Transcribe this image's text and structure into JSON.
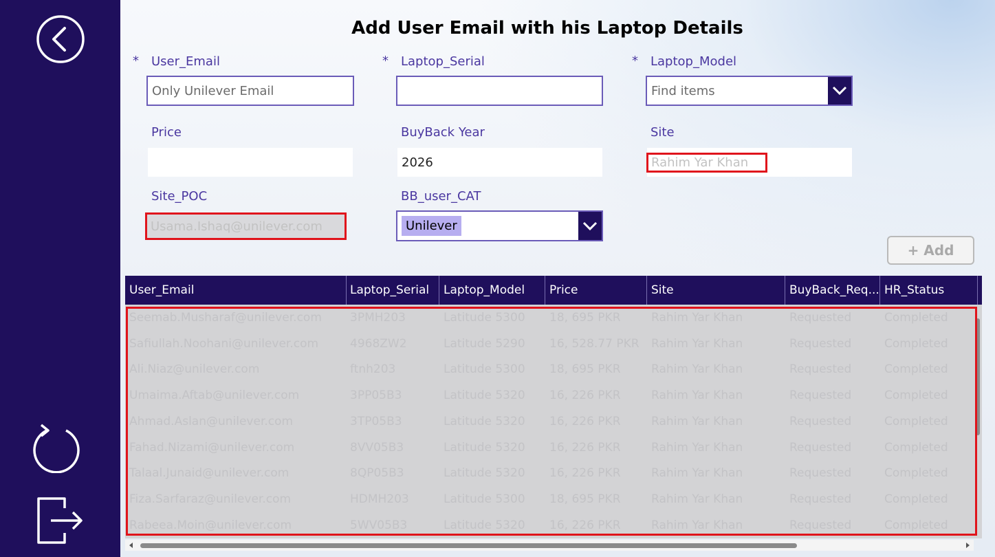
{
  "title": "Add User Email with his Laptop Details",
  "required_marker": "*",
  "form": {
    "user_email": {
      "label": "User_Email",
      "placeholder": "Only Unilever Email",
      "value": ""
    },
    "laptop_serial": {
      "label": "Laptop_Serial",
      "value": ""
    },
    "laptop_model": {
      "label": "Laptop_Model",
      "placeholder": "Find items"
    },
    "price": {
      "label": "Price",
      "value": ""
    },
    "buyback_year": {
      "label": "BuyBack Year",
      "value": "2026"
    },
    "site": {
      "label": "Site",
      "value": "Rahim Yar Khan"
    },
    "site_poc": {
      "label": "Site_POC",
      "value": "Usama.Ishaq@unilever.com"
    },
    "bb_user_cat": {
      "label": "BB_user_CAT",
      "value": "Unilever"
    }
  },
  "add_button": "+ Add",
  "table": {
    "columns": [
      "User_Email",
      "Laptop_Serial",
      "Laptop_Model",
      "Price",
      "Site",
      "BuyBack_Req...",
      "HR_Status"
    ],
    "rows": [
      [
        "Seemab.Musharaf@unilever.com",
        "3PMH203",
        "Latitude 5300",
        "18, 695 PKR",
        "Rahim Yar Khan",
        "Requested",
        "Completed"
      ],
      [
        "Safiullah.Noohani@unilever.com",
        "4968ZW2",
        "Latitude 5290",
        "16, 528.77 PKR",
        "Rahim Yar Khan",
        "Requested",
        "Completed"
      ],
      [
        "Ali.Niaz@unilever.com",
        "ftnh203",
        "Latitude 5300",
        "18, 695 PKR",
        "Rahim Yar Khan",
        "Requested",
        "Completed"
      ],
      [
        "Umaima.Aftab@unilever.com",
        "3PP05B3",
        "Latitude 5320",
        "16, 226 PKR",
        "Rahim Yar Khan",
        "Requested",
        "Completed"
      ],
      [
        "Ahmad.Aslan@unilever.com",
        "3TP05B3",
        "Latitude 5320",
        "16, 226 PKR",
        "Rahim Yar Khan",
        "Requested",
        "Completed"
      ],
      [
        "Fahad.Nizami@unilever.com",
        "8VV05B3",
        "Latitude 5320",
        "16, 226 PKR",
        "Rahim Yar Khan",
        "Requested",
        "Completed"
      ],
      [
        "Talaal.Junaid@unilever.com",
        "8QP05B3",
        "Latitude 5320",
        "16, 226 PKR",
        "Rahim Yar Khan",
        "Requested",
        "Completed"
      ],
      [
        "Fiza.Sarfaraz@unilever.com",
        "HDMH203",
        "Latitude 5300",
        "18, 695 PKR",
        "Rahim Yar Khan",
        "Requested",
        "Completed"
      ],
      [
        "Rabeea.Moin@unilever.com",
        "5WV05B3",
        "Latitude 5320",
        "16, 226 PKR",
        "Rahim Yar Khan",
        "Requested",
        "Completed"
      ]
    ]
  },
  "icons": {
    "back": "back-arrow-icon",
    "refresh": "refresh-icon",
    "logout": "logout-icon",
    "dropdown": "chevron-down-icon"
  },
  "colors": {
    "sidebar": "#1f0f5c",
    "label": "#4a37a0",
    "highlight": "#e0141c",
    "selected_chip": "#b7aef0"
  }
}
